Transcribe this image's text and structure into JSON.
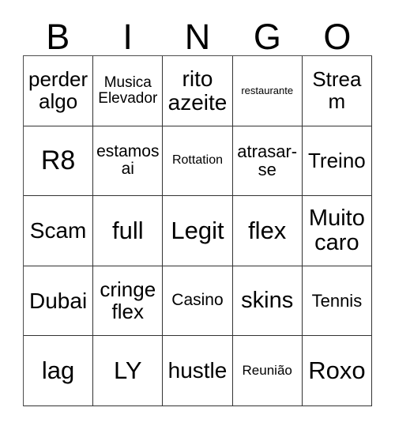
{
  "card": {
    "header_letters": [
      "B",
      "I",
      "N",
      "G",
      "O"
    ],
    "rows": [
      [
        {
          "text": "perder algo",
          "size": "fs-xl"
        },
        {
          "text": "Musica Elevador",
          "size": "fs-md"
        },
        {
          "text": "rito azeite",
          "size": "fs-2xl"
        },
        {
          "text": "restaurante",
          "size": "fs-xs"
        },
        {
          "text": "Stream",
          "size": "fs-xl"
        }
      ],
      [
        {
          "text": "R8",
          "size": "fs-5xl"
        },
        {
          "text": "estamos ai",
          "size": "fs-mdl"
        },
        {
          "text": "Rottation",
          "size": "fs-sm"
        },
        {
          "text": "atrasar-se",
          "size": "fs-lg"
        },
        {
          "text": "Treino",
          "size": "fs-xl"
        }
      ],
      [
        {
          "text": "Scam",
          "size": "fs-2xl"
        },
        {
          "text": "full",
          "size": "fs-4xl"
        },
        {
          "text": "Legit",
          "size": "fs-4xl"
        },
        {
          "text": "flex",
          "size": "fs-4xl"
        },
        {
          "text": "Muito caro",
          "size": "fs-3xl"
        }
      ],
      [
        {
          "text": "Dubai",
          "size": "fs-2xl"
        },
        {
          "text": "cringe flex",
          "size": "fs-xl"
        },
        {
          "text": "Casino",
          "size": "fs-mdl"
        },
        {
          "text": "skins",
          "size": "fs-3xl"
        },
        {
          "text": "Tennis",
          "size": "fs-lg"
        }
      ],
      [
        {
          "text": "lag",
          "size": "fs-4xl"
        },
        {
          "text": "LY",
          "size": "fs-4xl"
        },
        {
          "text": "hustle",
          "size": "fs-2xl"
        },
        {
          "text": "Reunião",
          "size": "fs-smd"
        },
        {
          "text": "Roxo",
          "size": "fs-4xl"
        }
      ]
    ]
  },
  "colors": {
    "background": "#ffffff",
    "text": "#000000",
    "grid_line": "#333333"
  }
}
